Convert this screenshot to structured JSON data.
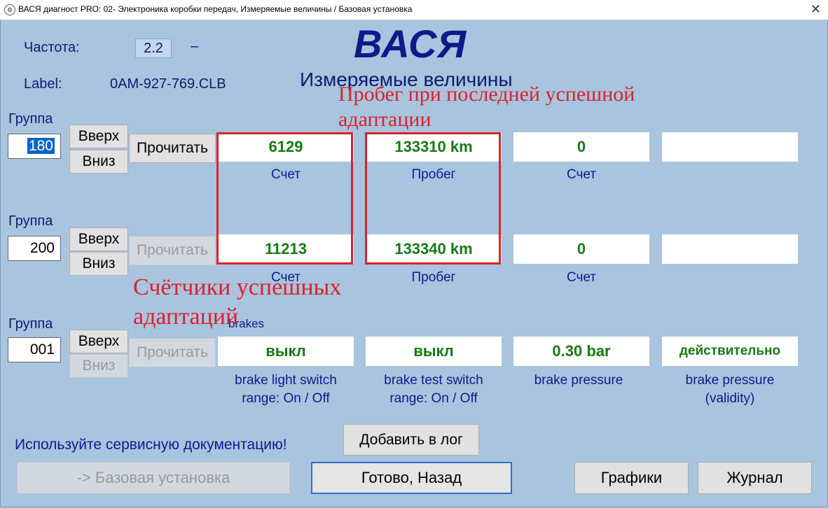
{
  "window": {
    "title": "ВАСЯ диагност PRO: 02- Электроника коробки передач,  Измеряемые величины / Базовая установка",
    "close": "✕"
  },
  "header": {
    "freq_label": "Частота:",
    "freq_value": "2.2",
    "freq_dash": "–",
    "label_label": "Label:",
    "label_value": "0AM-927-769.CLB",
    "logo": "ВАСЯ",
    "subtitle": "Измеряемые величины"
  },
  "groups": [
    {
      "label": "Группа",
      "value": "180",
      "up": "Вверх",
      "down": "Вниз",
      "read": "Прочитать",
      "cells": [
        {
          "value": "6129",
          "caption": "Счет"
        },
        {
          "value": "133310 km",
          "caption": "Пробег"
        },
        {
          "value": "0",
          "caption": "Счет"
        },
        {
          "value": "",
          "caption": ""
        }
      ]
    },
    {
      "label": "Группа",
      "value": "200",
      "up": "Вверх",
      "down": "Вниз",
      "read": "Прочитать",
      "cells": [
        {
          "value": "11213",
          "caption": "Счет"
        },
        {
          "value": "133340 km",
          "caption": "Пробег"
        },
        {
          "value": "0",
          "caption": "Счет"
        },
        {
          "value": "",
          "caption": ""
        }
      ]
    },
    {
      "label": "Группа",
      "value": "001",
      "up": "Вверх",
      "down": "Вниз",
      "read": "Прочитать",
      "group_title": "brakes",
      "cells": [
        {
          "value": "выкл",
          "caption1": "brake light switch",
          "caption2": "range: On / Off"
        },
        {
          "value": "выкл",
          "caption1": "brake test switch",
          "caption2": "range: On / Off"
        },
        {
          "value": "0.30 bar",
          "caption1": "brake pressure",
          "caption2": ""
        },
        {
          "value": "действительно",
          "caption1": "brake pressure",
          "caption2": "(validity)"
        }
      ]
    }
  ],
  "annotations": {
    "top_line1": "Пробег при последней успешной",
    "top_line2": "адаптации",
    "bottom_line1": "Счётчики успешных",
    "bottom_line2": "адаптаций"
  },
  "footer": {
    "service_note": "Используйте сервисную документацию!",
    "add_log": "Добавить в лог",
    "basic_setting": "-> Базовая установка",
    "done_back": "Готово, Назад",
    "graphs": "Графики",
    "journal": "Журнал"
  },
  "colors": {
    "background": "#a9c4df",
    "value_text": "#157a15",
    "annotation": "#d9232b",
    "label_text": "#0b1c6e"
  }
}
